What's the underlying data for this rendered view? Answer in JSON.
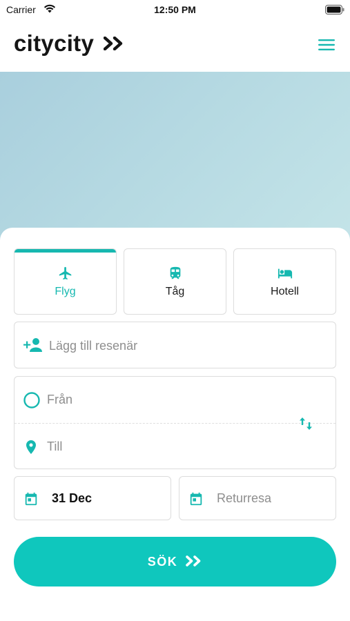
{
  "status_bar": {
    "carrier": "Carrier",
    "time": "12:50 PM"
  },
  "header": {
    "logo_text": "citycity",
    "logo_icon": "double-chevron-right-icon",
    "menu_icon": "hamburger-menu-icon"
  },
  "colors": {
    "accent": "#16b8b0",
    "search_button": "#0fc7bd",
    "border": "#dcdcdc",
    "placeholder": "#8e8e8e"
  },
  "tabs": [
    {
      "label": "Flyg",
      "icon": "airplane-icon",
      "active": true
    },
    {
      "label": "Tåg",
      "icon": "train-icon",
      "active": false
    },
    {
      "label": "Hotell",
      "icon": "hotel-bed-icon",
      "active": false
    }
  ],
  "traveler": {
    "placeholder": "Lägg till resenär",
    "icon": "add-person-icon"
  },
  "route": {
    "from_placeholder": "Från",
    "to_placeholder": "Till",
    "from_icon": "circle-origin-icon",
    "to_icon": "location-pin-icon",
    "swap_icon": "swap-vertical-icon"
  },
  "dates": {
    "depart_value": "31 Dec",
    "return_placeholder": "Returresa",
    "icon": "calendar-icon"
  },
  "search": {
    "label": "SÖK",
    "icon": "double-chevron-right-icon"
  }
}
